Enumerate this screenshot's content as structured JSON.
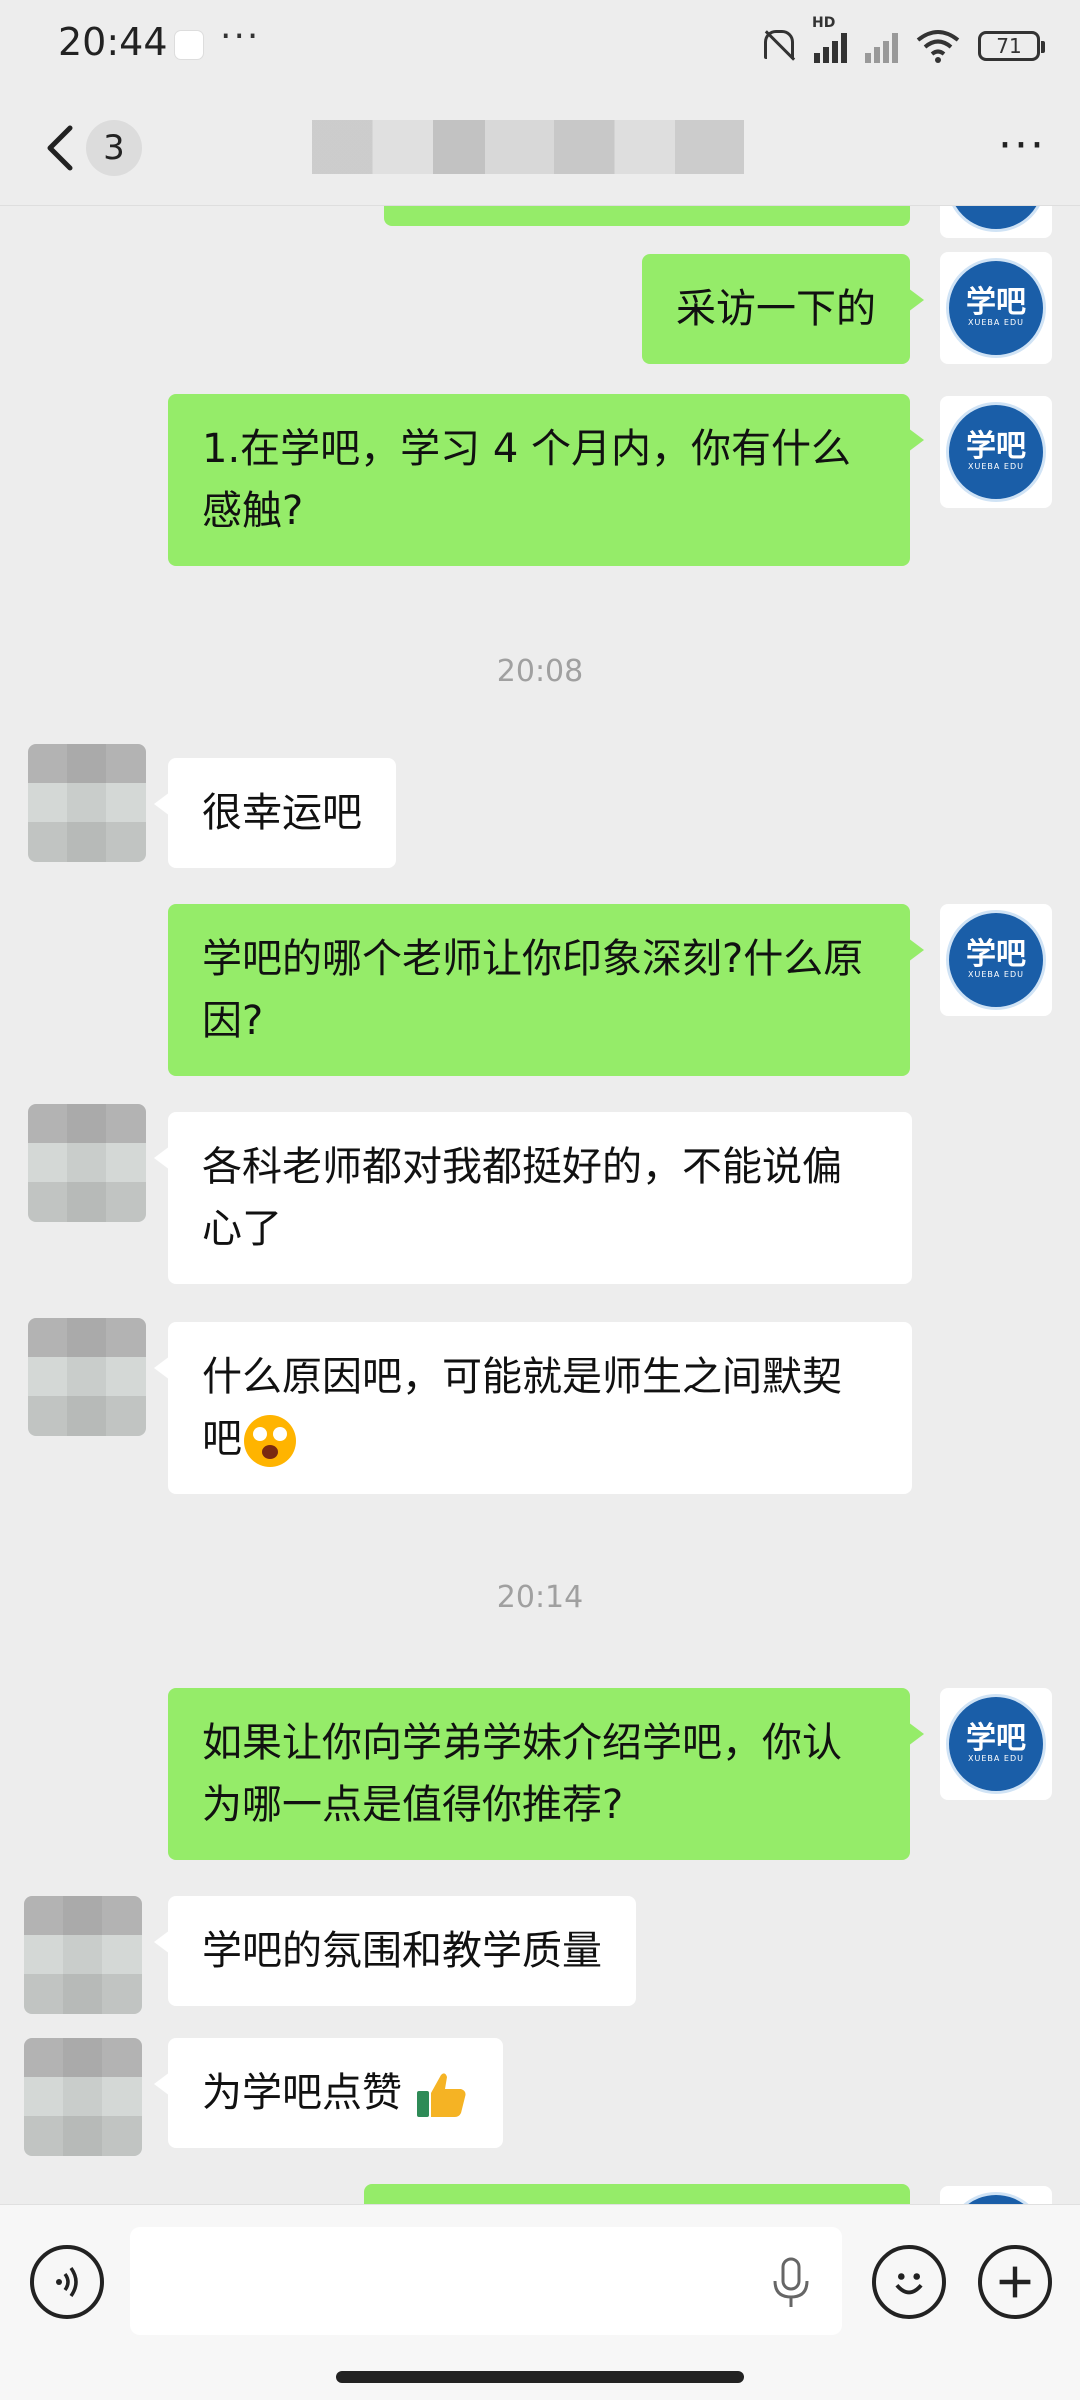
{
  "status_bar": {
    "time": "20:44",
    "more": "···",
    "network_label": "HD",
    "battery": "71"
  },
  "header": {
    "back_icon": "chevron-left-icon",
    "unread_count": "3",
    "more": "···"
  },
  "messages": [
    {
      "side": "out",
      "text": "采访一下的"
    },
    {
      "side": "out",
      "text": "1.在学吧，学习 4 个月内，你有什么感触?"
    },
    {
      "side": "time",
      "text": "20:08"
    },
    {
      "side": "in",
      "text": "很幸运吧"
    },
    {
      "side": "out",
      "text": "学吧的哪个老师让你印象深刻?什么原因?"
    },
    {
      "side": "in",
      "text": "各科老师都对我都挺好的，不能说偏心了"
    },
    {
      "side": "in",
      "text": "什么原因吧，可能就是师生之间默契吧",
      "emoji": "surprised-face-emoji"
    },
    {
      "side": "time",
      "text": "20:14"
    },
    {
      "side": "out",
      "text": "如果让你向学弟学妹介绍学吧，你认为哪一点是值得你推荐?"
    },
    {
      "side": "in",
      "text": "学吧的氛围和教学质量"
    },
    {
      "side": "in",
      "text": "为学吧点赞",
      "emoji": "thumbs-up-emoji"
    }
  ],
  "brand_avatar": {
    "text": "学吧",
    "subtext": "XUEBA EDU",
    "color": "#1a5ea8"
  },
  "colors": {
    "outgoing_bubble": "#95ec69",
    "incoming_bubble": "#ffffff",
    "background": "#ededed"
  },
  "input_bar": {
    "voice_icon": "voice-mode-icon",
    "placeholder": "",
    "mic_icon": "microphone-icon",
    "emoji_icon": "emoji-icon",
    "add_icon": "plus-icon"
  }
}
